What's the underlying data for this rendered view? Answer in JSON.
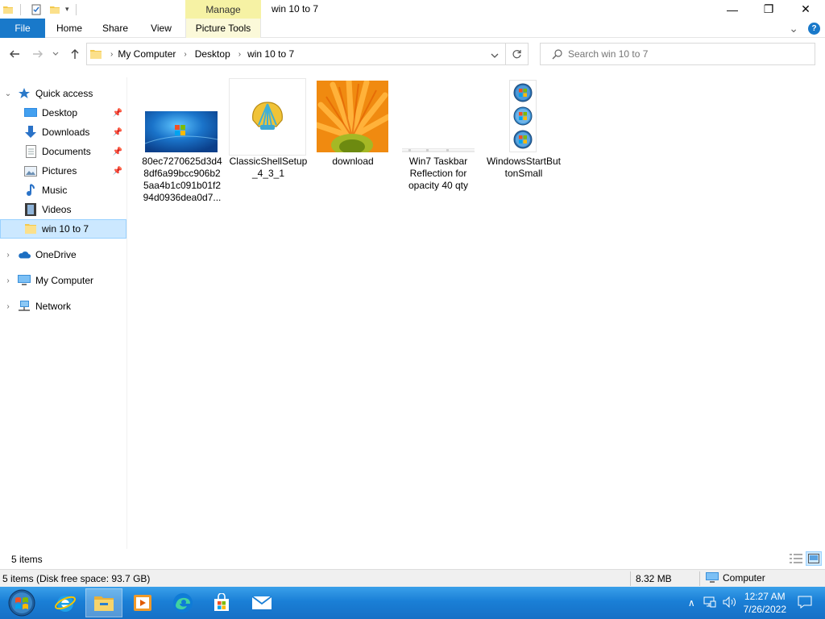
{
  "window": {
    "title": "win 10 to 7",
    "context_tab": "Manage",
    "minimize_glyph": "—",
    "maximize_glyph": "❐",
    "close_glyph": "✕"
  },
  "ribbon": {
    "file": "File",
    "tabs": [
      "Home",
      "Share",
      "View",
      "Picture Tools"
    ],
    "expand_glyph": "⌄",
    "help_glyph": "?"
  },
  "address": {
    "crumbs": [
      "My Computer",
      "Desktop",
      "win 10 to 7"
    ],
    "search_placeholder": "Search win 10 to 7"
  },
  "nav": {
    "quick_access": "Quick access",
    "items": [
      {
        "label": "Desktop",
        "pinned": true
      },
      {
        "label": "Downloads",
        "pinned": true
      },
      {
        "label": "Documents",
        "pinned": true
      },
      {
        "label": "Pictures",
        "pinned": true
      },
      {
        "label": "Music",
        "pinned": false
      },
      {
        "label": "Videos",
        "pinned": false
      },
      {
        "label": "win 10 to 7",
        "pinned": false
      }
    ],
    "roots": [
      "OneDrive",
      "My Computer",
      "Network"
    ]
  },
  "files": [
    {
      "name": "80ec7270625d3d48df6a99bcc906b25aa4b1c091b01f294d0936dea0d7...",
      "lines": [
        "80ec7270625d3d4",
        "8df6a99bcc906b2",
        "5aa4b1c091b01f2",
        "94d0936dea0d7..."
      ]
    },
    {
      "name": "ClassicShellSetup_4_3_1",
      "lines": [
        "ClassicShellSetup",
        "_4_3_1"
      ]
    },
    {
      "name": "download",
      "lines": [
        "download"
      ]
    },
    {
      "name": "Win7 Taskbar Reflection for opacity 40 qty",
      "lines": [
        "Win7 Taskbar",
        "Reflection for",
        "opacity 40 qty"
      ]
    },
    {
      "name": "WindowsStartButtonSmall",
      "lines": [
        "WindowsStartBut",
        "tonSmall"
      ]
    }
  ],
  "status": {
    "items_count": "5 items",
    "disk_info": "5 items (Disk free space: 93.7 GB)",
    "size": "8.32 MB",
    "zone": "Computer"
  },
  "taskbar": {
    "time": "12:27 AM",
    "date": "7/26/2022"
  },
  "colors": {
    "file_tab": "#1979ca",
    "manage_tab": "#f6f2a4",
    "selection": "#cce8ff",
    "taskbar": "#1a7fd6"
  }
}
